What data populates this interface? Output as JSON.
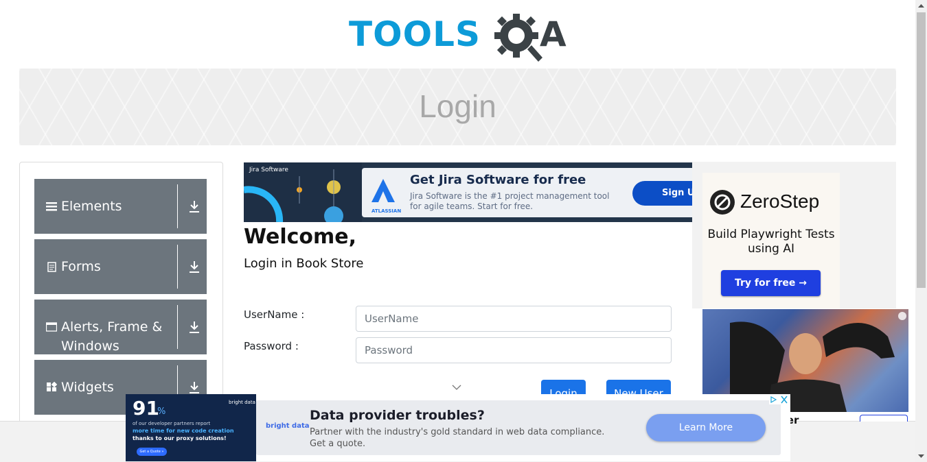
{
  "header": {
    "logo_tools": "TOOLS",
    "logo_qa": "A"
  },
  "banner": {
    "title": "Login"
  },
  "sidebar": {
    "groups": [
      {
        "label": "Elements",
        "icon": "menu-icon"
      },
      {
        "label": "Forms",
        "icon": "document-icon"
      },
      {
        "label": "Alerts, Frame & Windows",
        "icon": "window-icon"
      },
      {
        "label": "Widgets",
        "icon": "widgets-icon"
      }
    ]
  },
  "top_ad": {
    "brand": "Jira Software",
    "atlassian": "ATLASSIAN",
    "headline": "Get Jira Software for free",
    "body": "Jira Software is the #1 project management tool for agile teams. Start for free.",
    "cta": "Sign Up"
  },
  "main": {
    "welcome": "Welcome,",
    "subtitle": "Login in Book Store",
    "username_label": "UserName :",
    "username_placeholder": "UserName",
    "password_label": "Password :",
    "password_placeholder": "Password",
    "login_button": "Login",
    "new_user_button": "New User"
  },
  "right_ad": {
    "brand": "ZeroStep",
    "tagline": "Build Playwright Tests using AI",
    "cta": "Try for free →",
    "partial_text": "auer"
  },
  "bottom_ad": {
    "stat": "91",
    "stat_unit": "%",
    "stat_line1": "of our developer partners report",
    "stat_line2": "more time for new code creation",
    "stat_line3": "thanks to our proxy solutions!",
    "small_cta": "Get a Quote »",
    "brand": "bright data",
    "headline": "Data provider troubles?",
    "body": "Partner with the industry's gold standard in web data compliance. Get a quote.",
    "cta": "Learn More"
  },
  "colors": {
    "accent": "#1a73e8",
    "sidebar": "#6c757d",
    "logo_blue": "#0d9bd8"
  }
}
